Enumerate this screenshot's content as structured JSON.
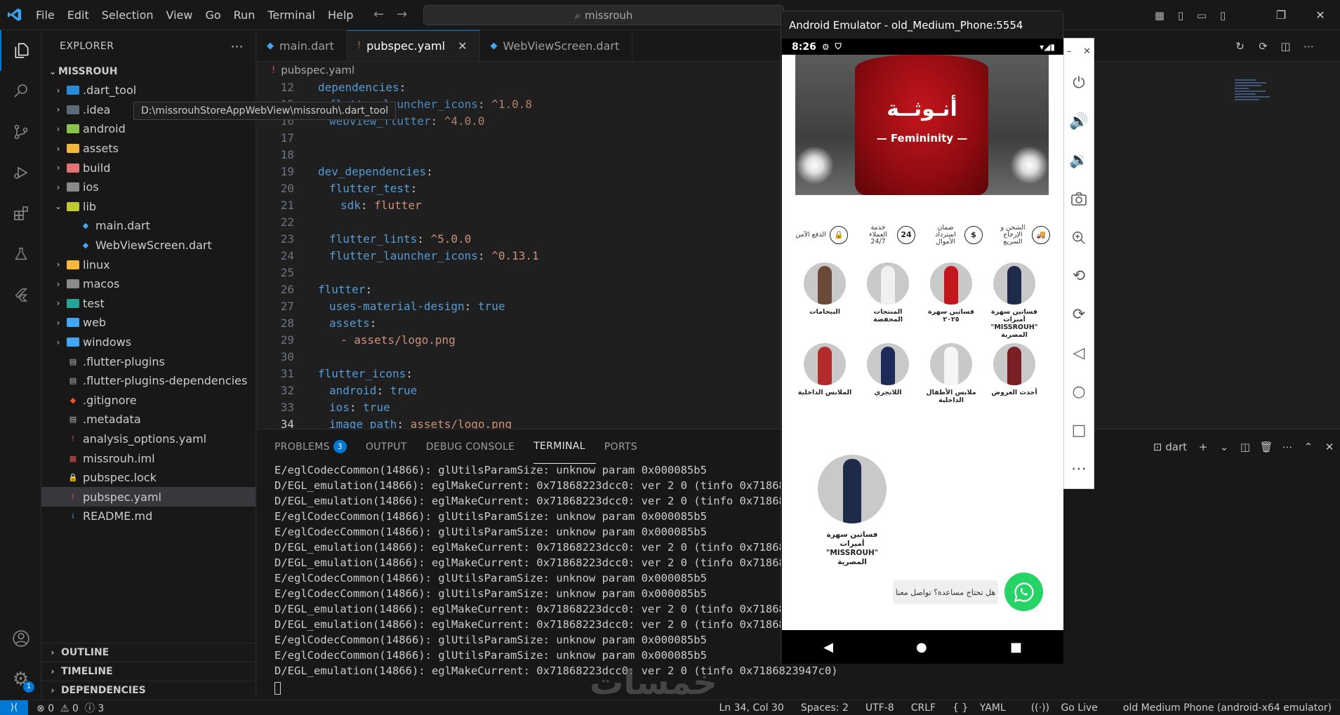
{
  "titlebar": {
    "menu": [
      "File",
      "Edit",
      "Selection",
      "View",
      "Go",
      "Run",
      "Terminal",
      "Help"
    ],
    "search": "missrouh"
  },
  "explorer": {
    "title": "EXPLORER",
    "project": "MISSROUH",
    "items": [
      {
        "label": ".dart_tool",
        "type": "folder",
        "icon_color": "#2b8ad8",
        "open": false,
        "depth": 1
      },
      {
        "label": ".idea",
        "type": "folder",
        "icon_color": "#5c6b7a",
        "open": false,
        "depth": 1
      },
      {
        "label": "android",
        "type": "folder",
        "icon_color": "#8bc34a",
        "open": false,
        "depth": 1
      },
      {
        "label": "assets",
        "type": "folder",
        "icon_color": "#f5b83d",
        "open": false,
        "depth": 1
      },
      {
        "label": "build",
        "type": "folder",
        "icon_color": "#e57373",
        "open": false,
        "depth": 1
      },
      {
        "label": "ios",
        "type": "folder",
        "icon_color": "#8a8a8a",
        "open": false,
        "depth": 1
      },
      {
        "label": "lib",
        "type": "folder",
        "icon_color": "#c0ca33",
        "open": true,
        "depth": 1
      },
      {
        "label": "main.dart",
        "type": "dart",
        "icon_color": "#42a5f5",
        "depth": 2
      },
      {
        "label": "WebViewScreen.dart",
        "type": "dart",
        "icon_color": "#42a5f5",
        "depth": 2
      },
      {
        "label": "linux",
        "type": "folder",
        "icon_color": "#f5b83d",
        "open": false,
        "depth": 1
      },
      {
        "label": "macos",
        "type": "folder",
        "icon_color": "#8a8a8a",
        "open": false,
        "depth": 1
      },
      {
        "label": "test",
        "type": "folder",
        "icon_color": "#26a69a",
        "open": false,
        "depth": 1
      },
      {
        "label": "web",
        "type": "folder",
        "icon_color": "#42a5f5",
        "open": false,
        "depth": 1
      },
      {
        "label": "windows",
        "type": "folder",
        "icon_color": "#42a5f5",
        "open": false,
        "depth": 1
      },
      {
        "label": ".flutter-plugins",
        "type": "file",
        "icon_color": "#bbbbbb",
        "depth": 1
      },
      {
        "label": ".flutter-plugins-dependencies",
        "type": "file",
        "icon_color": "#bbbbbb",
        "depth": 1
      },
      {
        "label": ".gitignore",
        "type": "git",
        "icon_color": "#e4572e",
        "depth": 1
      },
      {
        "label": ".metadata",
        "type": "file",
        "icon_color": "#bbbbbb",
        "depth": 1
      },
      {
        "label": "analysis_options.yaml",
        "type": "yaml",
        "icon_color": "#e35151",
        "depth": 1
      },
      {
        "label": "missrouh.iml",
        "type": "iml",
        "icon_color": "#e35151",
        "depth": 1
      },
      {
        "label": "pubspec.lock",
        "type": "lock",
        "icon_color": "#f5c518",
        "depth": 1
      },
      {
        "label": "pubspec.yaml",
        "type": "yaml",
        "icon_color": "#e35151",
        "depth": 1,
        "selected": true
      },
      {
        "label": "README.md",
        "type": "info",
        "icon_color": "#42a5f5",
        "depth": 1
      }
    ],
    "sections": [
      "OUTLINE",
      "TIMELINE",
      "DEPENDENCIES"
    ],
    "tooltip": "D:\\missrouhStoreAppWebView\\missrouh\\.dart_tool"
  },
  "tabs": [
    {
      "label": "main.dart",
      "icon": "dart",
      "active": false
    },
    {
      "label": "pubspec.yaml",
      "icon": "yaml",
      "active": true
    },
    {
      "label": "WebViewScreen.dart",
      "icon": "dart",
      "active": false
    }
  ],
  "breadcrumb": "pubspec.yaml",
  "code": [
    {
      "n": "12",
      "indent": 0,
      "key": "dependencies",
      "val": "",
      "vcls": ""
    },
    {
      "n": "15",
      "indent": 1,
      "key": "flutter_launcher_icons",
      "val": "^1.0.8",
      "vcls": "s",
      "clip": true
    },
    {
      "n": "16",
      "indent": 1,
      "key": "webview_flutter",
      "val": "^4.0.0",
      "vcls": "s",
      "clip": true
    },
    {
      "n": "17",
      "indent": 0,
      "key": "",
      "val": "",
      "vcls": ""
    },
    {
      "n": "18",
      "indent": 0,
      "key": "",
      "val": "",
      "vcls": ""
    },
    {
      "n": "19",
      "indent": 0,
      "key": "dev_dependencies",
      "val": "",
      "vcls": ""
    },
    {
      "n": "20",
      "indent": 1,
      "key": "flutter_test",
      "val": "",
      "vcls": ""
    },
    {
      "n": "21",
      "indent": 2,
      "key": "sdk",
      "val": "flutter",
      "vcls": "s"
    },
    {
      "n": "22",
      "indent": 0,
      "key": "",
      "val": "",
      "vcls": ""
    },
    {
      "n": "23",
      "indent": 1,
      "key": "flutter_lints",
      "val": "^5.0.0",
      "vcls": "s"
    },
    {
      "n": "24",
      "indent": 1,
      "key": "flutter_launcher_icons",
      "val": "^0.13.1",
      "vcls": "s"
    },
    {
      "n": "25",
      "indent": 0,
      "key": "",
      "val": "",
      "vcls": ""
    },
    {
      "n": "26",
      "indent": 0,
      "key": "flutter",
      "val": "",
      "vcls": ""
    },
    {
      "n": "27",
      "indent": 1,
      "key": "uses-material-design",
      "val": "true",
      "vcls": "b"
    },
    {
      "n": "28",
      "indent": 1,
      "key": "assets",
      "val": "",
      "vcls": ""
    },
    {
      "n": "29",
      "indent": 2,
      "key": "",
      "val": "- assets/logo.png",
      "vcls": "s"
    },
    {
      "n": "30",
      "indent": 0,
      "key": "",
      "val": "",
      "vcls": ""
    },
    {
      "n": "31",
      "indent": 0,
      "key": "flutter_icons",
      "val": "",
      "vcls": ""
    },
    {
      "n": "32",
      "indent": 1,
      "key": "android",
      "val": "true",
      "vcls": "b"
    },
    {
      "n": "33",
      "indent": 1,
      "key": "ios",
      "val": "true",
      "vcls": "b"
    },
    {
      "n": "34",
      "indent": 1,
      "key": "image_path",
      "val": "assets/logo.png",
      "vcls": "s",
      "current": true
    }
  ],
  "panel": {
    "tabs": [
      {
        "label": "PROBLEMS",
        "count": "3"
      },
      {
        "label": "OUTPUT"
      },
      {
        "label": "DEBUG CONSOLE"
      },
      {
        "label": "TERMINAL",
        "active": true
      },
      {
        "label": "PORTS"
      }
    ],
    "terminal_name": "dart",
    "lines": [
      "E/eglCodecCommon(14866): glUtilsParamSize: unknow param 0x000085b5",
      "D/EGL_emulation(14866): eglMakeCurrent: 0x71868223dcc0: ver 2 0 (tinfo 0x71868239",
      "D/EGL_emulation(14866): eglMakeCurrent: 0x71868223dcc0: ver 2 0 (tinfo 0x71868239",
      "E/eglCodecCommon(14866): glUtilsParamSize: unknow param 0x000085b5",
      "E/eglCodecCommon(14866): glUtilsParamSize: unknow param 0x000085b5",
      "D/EGL_emulation(14866): eglMakeCurrent: 0x71868223dcc0: ver 2 0 (tinfo 0x71868239",
      "D/EGL_emulation(14866): eglMakeCurrent: 0x71868223dcc0: ver 2 0 (tinfo 0x71868239",
      "E/eglCodecCommon(14866): glUtilsParamSize: unknow param 0x000085b5",
      "E/eglCodecCommon(14866): glUtilsParamSize: unknow param 0x000085b5",
      "D/EGL_emulation(14866): eglMakeCurrent: 0x71868223dcc0: ver 2 0 (tinfo 0x71868239",
      "D/EGL_emulation(14866): eglMakeCurrent: 0x71868223dcc0: ver 2 0 (tinfo 0x71868239",
      "E/eglCodecCommon(14866): glUtilsParamSize: unknow param 0x000085b5",
      "E/eglCodecCommon(14866): glUtilsParamSize: unknow param 0x000085b5",
      "D/EGL_emulation(14866): eglMakeCurrent: 0x71868223dcc0: ver 2 0 (tinfo 0x7186823947c0)"
    ]
  },
  "statusbar": {
    "errors": "0",
    "warnings": "0",
    "info": "3",
    "position": "Ln 34, Col 30",
    "spaces": "Spaces: 2",
    "encoding": "UTF-8",
    "eol": "CRLF",
    "language": "YAML",
    "golive": "Go Live",
    "device": "old Medium Phone (android-x64 emulator)"
  },
  "watermark": "خمسات",
  "emulator": {
    "title": "Android Emulator - old_Medium_Phone:5554",
    "time": "8:26",
    "hero_ar": "أنـوثــة",
    "hero_en": "— Femininity —",
    "features": [
      {
        "text": "الشحن و الإرجاع السريع",
        "icon": "🚚"
      },
      {
        "text": "ضمان استرداد الأموال",
        "icon": "$"
      },
      {
        "text": "خدمة العملاء 24/7",
        "icon": "24"
      },
      {
        "text": "الدفع الآمن",
        "icon": "🔒"
      }
    ],
    "categories_row1": [
      {
        "label": "فساتين سهرة أميرات \"MISSROUH\" المصرية",
        "color": "#1d2a4a"
      },
      {
        "label": "فساتين سهرة ٢٠٢٥",
        "color": "#c3161d"
      },
      {
        "label": "المنتجات المخفضة",
        "color": "#f0f0f0"
      },
      {
        "label": "البيجامات",
        "color": "#6b4a3a"
      }
    ],
    "categories_row2": [
      {
        "label": "أحدث العروض",
        "color": "#7a1f26"
      },
      {
        "label": "ملابس الأطفال الداخلية",
        "color": "#f5f5f5"
      },
      {
        "label": "اللانجري",
        "color": "#1d2a5a"
      },
      {
        "label": "الملابس الداخلية",
        "color": "#b52b2b"
      }
    ],
    "big_category": "فساتين سهرة أميرات \"MISSROUH\" المصرية",
    "help_text": "هل تحتاج مساعدة؟ تواصل معنا"
  },
  "colors": {
    "accent": "#0078d4",
    "whatsapp": "#25d366"
  }
}
